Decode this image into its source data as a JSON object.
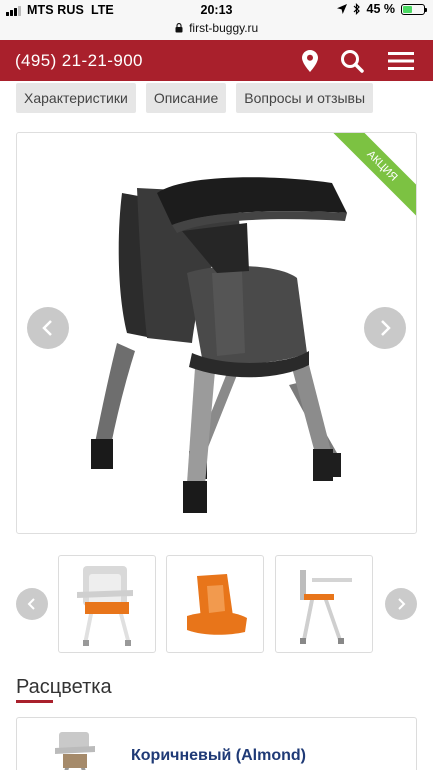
{
  "status_bar": {
    "carrier": "MTS RUS",
    "network": "LTE",
    "time": "20:13",
    "battery": "45 %",
    "battery_level": 0.45,
    "icons": [
      "signal-icon",
      "location-arrow-icon",
      "bluetooth-icon",
      "battery-icon"
    ]
  },
  "browser": {
    "url": "first-buggy.ru",
    "icons": [
      "lock-icon"
    ]
  },
  "header": {
    "phone": "(495) 21-21-900",
    "background": "#a9202c",
    "icons": [
      "map-pin-icon",
      "search-icon",
      "hamburger-menu-icon"
    ]
  },
  "tabs": [
    {
      "label": "Характеристики"
    },
    {
      "label": "Описание"
    },
    {
      "label": "Вопросы и отзывы"
    }
  ],
  "product_image": {
    "badge": "АКЦИЯ",
    "badge_color": "#7cc242",
    "icons": [
      "chevron-left-icon",
      "chevron-right-icon"
    ]
  },
  "thumbnails": {
    "count": 3,
    "icons": [
      "chevron-left-icon",
      "chevron-right-icon"
    ]
  },
  "colors_section": {
    "title": "Расцветка",
    "items": [
      {
        "name": "Коричневый (Almond)"
      }
    ]
  }
}
